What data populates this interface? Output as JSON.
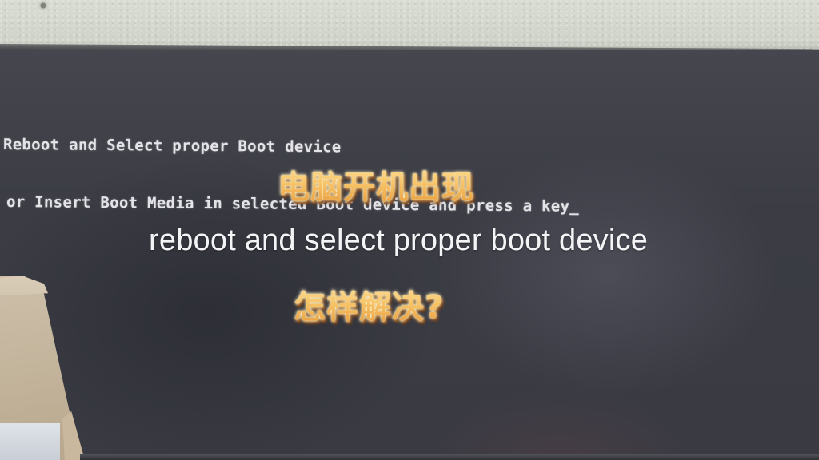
{
  "bios_message": {
    "line1": "Reboot and Select proper Boot device",
    "line2": "or Insert Boot Media in selected Boot device and press a key",
    "cursor": "_"
  },
  "captions": {
    "title_cn": "电脑开机出现",
    "error_en": "reboot and select proper boot device",
    "question_cn": "怎样解决?"
  },
  "colors": {
    "screen_background": "#3c3d45",
    "bios_text": "#e4e4e8",
    "caption_gold": "#f7c36a",
    "caption_white": "#f4f4f6"
  }
}
